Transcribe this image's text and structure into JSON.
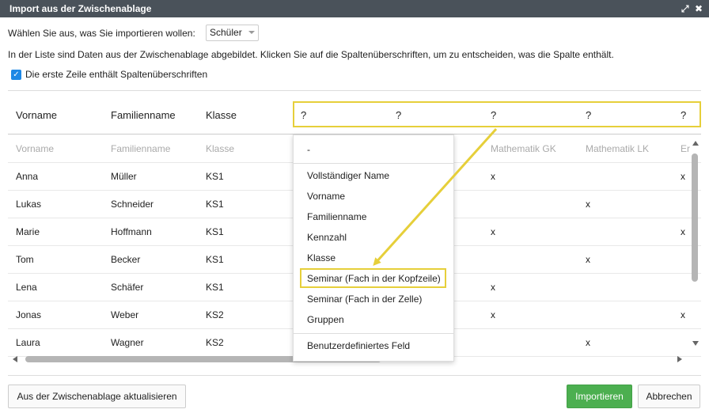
{
  "window": {
    "title": "Import aus der Zwischenablage",
    "maximize_glyph": "⤢",
    "close_glyph": "✖"
  },
  "import_type": {
    "label": "Wählen Sie aus, was Sie importieren wollen:",
    "value": "Schüler"
  },
  "info_text": "In der Liste sind Daten aus der Zwischenablage abgebildet. Klicken Sie auf die Spaltenüberschriften, um zu entscheiden, was die Spalte enthält.",
  "header_checkbox": {
    "label": "Die erste Zeile enthält Spaltenüberschriften",
    "checked": true
  },
  "table": {
    "headers": [
      "Vorname",
      "Familienname",
      "Klasse",
      "?",
      "?",
      "?",
      "?",
      "?"
    ],
    "header_row_grey": [
      "Vorname",
      "Familienname",
      "Klasse",
      "Mathematik GK",
      "Mathematik LK",
      "Er"
    ],
    "rows": [
      {
        "vorname": "Anna",
        "familienname": "Müller",
        "klasse": "KS1",
        "mgk": "x",
        "mlk": "",
        "er": "x"
      },
      {
        "vorname": "Lukas",
        "familienname": "Schneider",
        "klasse": "KS1",
        "mgk": "",
        "mlk": "x",
        "er": ""
      },
      {
        "vorname": "Marie",
        "familienname": "Hoffmann",
        "klasse": "KS1",
        "mgk": "x",
        "mlk": "",
        "er": "x"
      },
      {
        "vorname": "Tom",
        "familienname": "Becker",
        "klasse": "KS1",
        "mgk": "",
        "mlk": "x",
        "er": ""
      },
      {
        "vorname": "Lena",
        "familienname": "Schäfer",
        "klasse": "KS1",
        "mgk": "x",
        "mlk": "",
        "er": ""
      },
      {
        "vorname": "Jonas",
        "familienname": "Weber",
        "klasse": "KS2",
        "mgk": "x",
        "mlk": "",
        "er": "x"
      },
      {
        "vorname": "Laura",
        "familienname": "Wagner",
        "klasse": "KS2",
        "mgk": "",
        "mlk": "x",
        "er": ""
      }
    ]
  },
  "dropdown": {
    "items": [
      "-",
      "Vollständiger Name",
      "Vorname",
      "Familienname",
      "Kennzahl",
      "Klasse",
      "Seminar (Fach in der Kopfzeile)",
      "Seminar (Fach in der Zelle)",
      "Gruppen",
      "Benutzerdefiniertes Feld"
    ],
    "highlighted": "Seminar (Fach in der Kopfzeile)"
  },
  "buttons": {
    "refresh": "Aus der Zwischenablage aktualisieren",
    "import": "Importieren",
    "cancel": "Abbrechen"
  },
  "colors": {
    "accent": "#4caf50",
    "highlight": "#e6cf3a",
    "checkbox": "#1e88e5",
    "titlebar": "#4a525a"
  }
}
